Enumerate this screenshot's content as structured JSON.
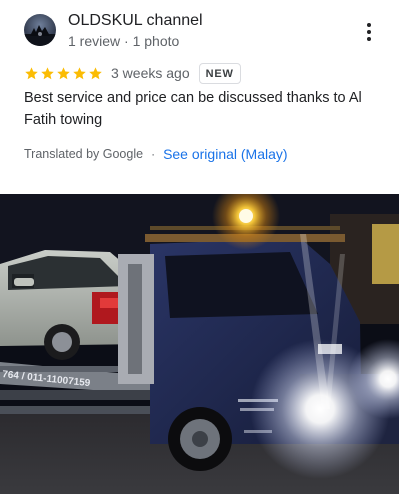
{
  "review": {
    "author": {
      "name": "OLDSKUL channel",
      "meta": "1 review · 1 photo",
      "avatar_icon": "profile-photo-icon"
    },
    "more_icon": "more-vert-icon",
    "rating": {
      "stars": 5,
      "max_stars": 5,
      "star_color": "#fbbc04"
    },
    "date": "3 weeks ago",
    "badge": "NEW",
    "text": "Best service and price can be discussed thanks to Al Fatih towing",
    "translation": {
      "label": "Translated by Google",
      "separator": "·",
      "link": "See original (Malay)"
    },
    "photo": {
      "truck_lettering": "764 / 011-11007159"
    }
  },
  "colors": {
    "link": "#1a73e8",
    "secondary_text": "#5f6368",
    "primary_text": "#202124"
  }
}
